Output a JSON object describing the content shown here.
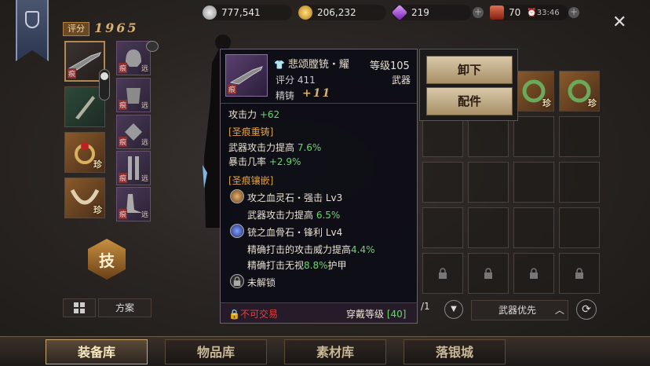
{
  "score": {
    "label": "评分",
    "value": "1965"
  },
  "currencies": [
    {
      "name": "silver",
      "value": "777,541",
      "color": "#c8c8c8"
    },
    {
      "name": "gold",
      "value": "206,232",
      "color": "#d8a830"
    },
    {
      "name": "diamond",
      "value": "219",
      "color": "#b060e0"
    },
    {
      "name": "ticket",
      "value": "70",
      "color": "#c05030"
    }
  ],
  "timer": "33:46",
  "slot_tags": {
    "zhen": "痕",
    "yuan": "远",
    "zhen_rare": "珍"
  },
  "tooltip": {
    "item_name": "悲颂膛铳・耀",
    "level_label": "等级105",
    "score_label": "评分 411",
    "type": "武器",
    "forge_label": "精铸",
    "forge_value": "+11",
    "item_tag": "痕",
    "attack_label": "攻击力",
    "attack_value": "+62",
    "section1": "[圣痕重铸]",
    "stat1_label": "武器攻击力提高",
    "stat1_value": "7.6%",
    "stat2_label": "暴击几率",
    "stat2_value": "+2.9%",
    "section2": "[圣痕镶嵌]",
    "gem1_name": "攻之血灵石・强击 Lv3",
    "gem1_stat_label": "武器攻击力提高",
    "gem1_stat_value": "6.5%",
    "gem2_name": "铳之血骨石・锋利 Lv4",
    "gem2_stat1_label": "精确打击的攻击威力提高",
    "gem2_stat1_value": "4.4%",
    "gem2_stat2_label": "精确打击无视",
    "gem2_stat2_value": "8.8%",
    "gem2_stat2_suffix": "护甲",
    "locked_label": "未解锁",
    "trade_label": "不可交易",
    "wear_label": "穿戴等级",
    "wear_value": "[40]"
  },
  "actions": {
    "unequip": "卸下",
    "parts": "配件"
  },
  "skill_label": "技",
  "scheme_label": "方案",
  "page_indicator": "/1",
  "sort_label": "武器优先",
  "tabs": [
    "装备库",
    "物品库",
    "素材库",
    "落银城"
  ]
}
